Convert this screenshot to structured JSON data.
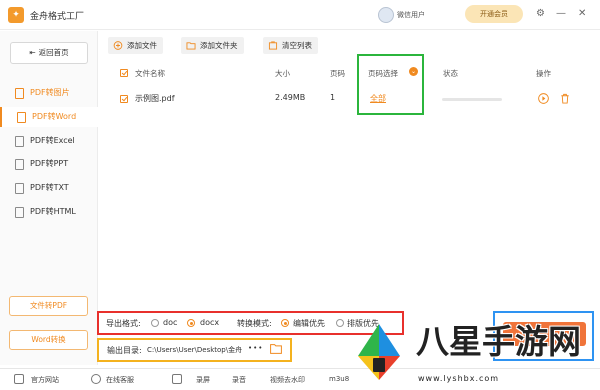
{
  "app": {
    "title": "金舟格式工厂",
    "user_name": "微信用户",
    "vip_label": "开通会员"
  },
  "window_controls": {
    "settings": "⚙",
    "minimize": "—",
    "close": "✕"
  },
  "sidebar": {
    "back_label": "返回首页",
    "items": [
      {
        "label": "PDF转图片"
      },
      {
        "label": "PDF转Word"
      },
      {
        "label": "PDF转Excel"
      },
      {
        "label": "PDF转PPT"
      },
      {
        "label": "PDF转TXT"
      },
      {
        "label": "PDF转HTML"
      }
    ],
    "button_1": "文件转PDF",
    "button_2": "Word转换"
  },
  "toolbar": {
    "add_file": "添加文件",
    "add_folder": "添加文件夹",
    "clear_list": "清空列表"
  },
  "table": {
    "headers": {
      "file_name": "文件名称",
      "size": "大小",
      "pages": "页码",
      "page_select": "页码选择",
      "status": "状态",
      "action": "操作"
    },
    "rows": [
      {
        "name": "示例图.pdf",
        "size": "2.49MB",
        "pages": "1",
        "page_select": "全部",
        "progress": 0
      }
    ]
  },
  "options": {
    "export_format_label": "导出格式:",
    "formats": [
      {
        "label": "doc",
        "selected": false
      },
      {
        "label": "docx",
        "selected": true
      }
    ],
    "mode_label": "转换模式:",
    "modes": [
      {
        "label": "编辑优先",
        "selected": true
      },
      {
        "label": "排版优先",
        "selected": false
      }
    ]
  },
  "output": {
    "label": "输出目录:",
    "path": "C:\\Users\\User\\Desktop\\金舟",
    "more": "•••"
  },
  "footer": {
    "site": "官方网站",
    "support": "在线客服",
    "record_screen": "录屏",
    "record_audio": "录音",
    "video_watermark": "视频去水印",
    "m3u8": "m3u8"
  },
  "watermark": {
    "text": "八星手游网",
    "url": "www.lyshbx.com"
  },
  "colors": {
    "accent": "#f08a20",
    "green_box": "#2bb53c",
    "red_box": "#e8302c",
    "yellow_box": "#f4b21e",
    "blue_box": "#2e93f2"
  }
}
